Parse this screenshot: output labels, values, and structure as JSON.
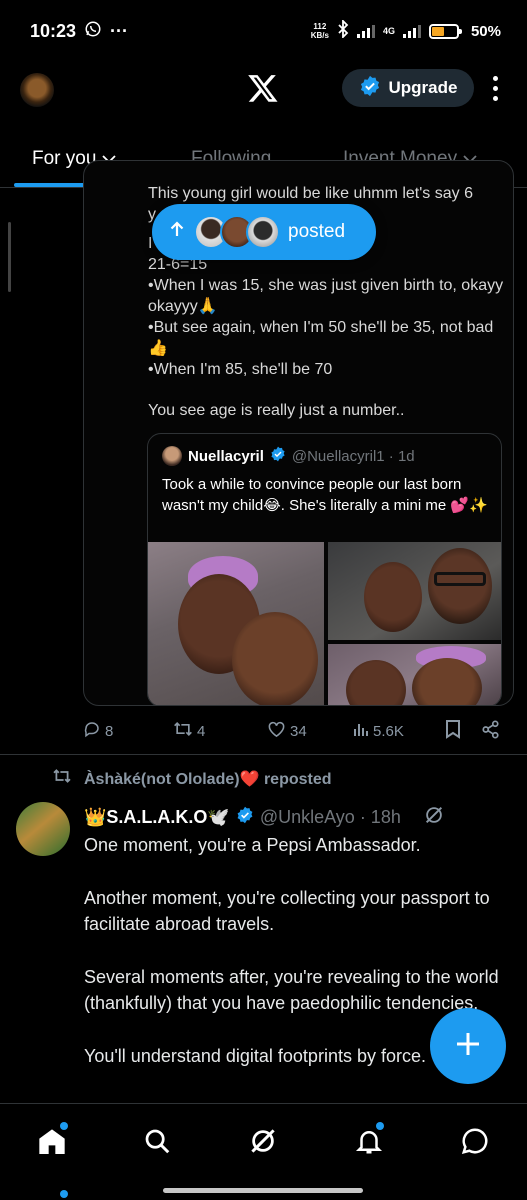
{
  "status_bar": {
    "time": "10:23",
    "more": "···",
    "net_speed_value": "112",
    "net_speed_unit": "KB/s",
    "network": "4G",
    "battery": "50%"
  },
  "header": {
    "upgrade_label": "Upgrade"
  },
  "tabs": [
    {
      "label": "For you"
    },
    {
      "label": "Following"
    },
    {
      "label": "Invent Money"
    }
  ],
  "quoted_post": {
    "lines": [
      "This young girl would be like uhmm let's say 6",
      "y",
      "I'",
      "21-6=15",
      "•When I was 15, she was just given birth to, okayy",
      "okayyy🙏",
      "•But see again, when I'm 50 she'll be 35, not bad",
      "👍",
      "•When I'm 85, she'll be 70",
      "",
      "You see age is really just a number.."
    ],
    "inner": {
      "name": "Nuellacyril",
      "handle_time": "@Nuellacyril1 · 1d",
      "text": "Took a while to convince people our last born wasn't my child😂. She's literally a mini me 💕✨"
    }
  },
  "posted_pill": {
    "label": "posted"
  },
  "post1_actions": {
    "replies": "8",
    "reposts": "4",
    "likes": "34",
    "views": "5.6K"
  },
  "post2": {
    "repost_by": "Àshàké(not Ololade)❤️ reposted",
    "name": "👑S.A.L.A.K.O🕊️",
    "handle_time": "@UnkleAyo · 18h",
    "paragraphs": [
      "One moment, you're a Pepsi Ambassador.",
      "Another moment, you're collecting your passport to facilitate abroad travels.",
      "Several moments after, you're revealing to the world (thankfully) that you have paedophilic tendencies.",
      "You'll understand digital footprints by force."
    ]
  },
  "colors": {
    "accent": "#1d9bf0",
    "background": "#000000",
    "muted": "#71767b",
    "divider": "#2f3336"
  },
  "icons": [
    "whatsapp-icon",
    "bluetooth-icon",
    "x-logo-icon",
    "verified-icon",
    "reply-icon",
    "repost-icon",
    "like-icon",
    "views-icon",
    "bookmark-icon",
    "share-icon",
    "grok-icon",
    "home-icon",
    "search-icon",
    "notifications-icon",
    "messages-icon",
    "plus-icon"
  ]
}
